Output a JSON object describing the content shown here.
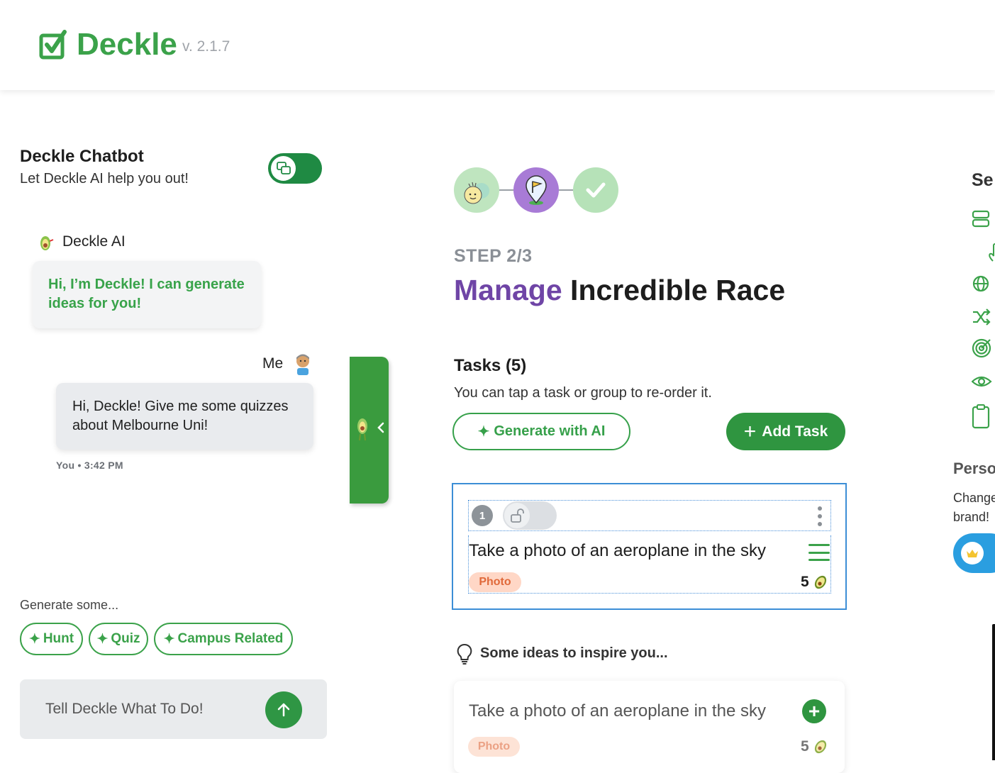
{
  "header": {
    "brand": "Deckle",
    "version": "v. 2.1.7",
    "logo_icon": "checkbox-logo-icon",
    "brand_color": "#3ba24a"
  },
  "chatbot": {
    "title": "Deckle Chatbot",
    "subtitle": "Let Deckle AI help you out!",
    "toggle_on": true,
    "toggle_color": "#1f8a43",
    "messages": [
      {
        "sender": "Deckle AI",
        "text": "Hi, I’m Deckle! I can generate ideas for you!"
      },
      {
        "sender": "Me",
        "text": "Hi, Deckle! Give me some quizzes about Melbourne Uni!",
        "meta": "You • 3:42 PM"
      }
    ],
    "generate_label": "Generate some...",
    "chips": [
      "Hunt",
      "Quiz",
      "Campus Related"
    ],
    "input_placeholder": "Tell Deckle What To Do!"
  },
  "main": {
    "step_label": "STEP 2/3",
    "title_accent": "Manage",
    "title_rest": " Incredible Race",
    "accent_color": "#6f45a6",
    "tasks_title": "Tasks (5)",
    "tasks_sub": "You can tap a task or group to re-order it.",
    "generate_ai_label": "Generate with AI",
    "add_task_label": "Add Task",
    "task": {
      "number": "1",
      "text": "Take a photo of an aeroplane in the sky",
      "tag": "Photo",
      "points": "5"
    },
    "ideas_title": "Some ideas to inspire you...",
    "idea": {
      "text": "Take a photo of an aeroplane in the sky",
      "tag": "Photo",
      "points": "5"
    }
  },
  "right_panel": {
    "title": "Se",
    "section_title": "Perso",
    "section_text_1": "Change",
    "section_text_2": "brand!"
  }
}
